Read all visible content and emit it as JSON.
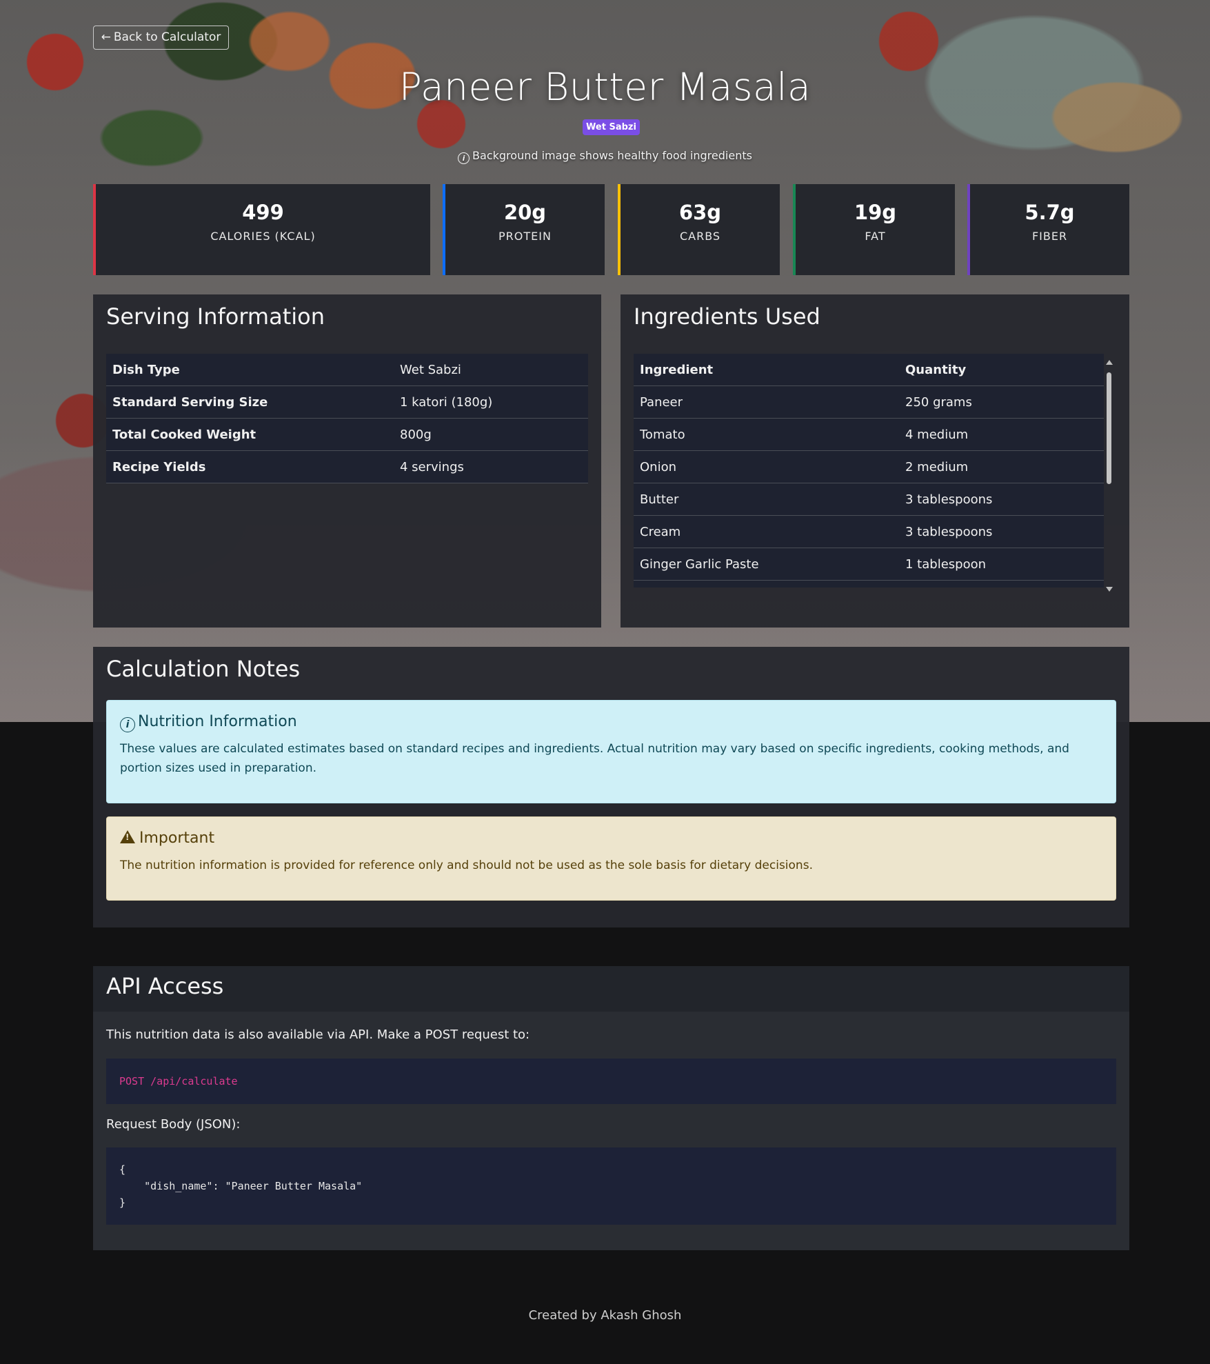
{
  "back_button": {
    "arrow_icon": "arrow-left-icon",
    "label": "Back to Calculator"
  },
  "dish": {
    "title": "Paneer Butter Masala",
    "badge": "Wet Sabzi",
    "badge_color": "#7a4ee6"
  },
  "background_note": {
    "icon": "info-circle-icon",
    "text": "Background image shows healthy food ingredients"
  },
  "stats": [
    {
      "value": "499",
      "label": "CALORIES (KCAL)",
      "color": "#dc3545"
    },
    {
      "value": "20g",
      "label": "PROTEIN",
      "color": "#0d6efd"
    },
    {
      "value": "63g",
      "label": "CARBS",
      "color": "#ffc107"
    },
    {
      "value": "19g",
      "label": "FAT",
      "color": "#198754"
    },
    {
      "value": "5.7g",
      "label": "FIBER",
      "color": "#6f42c1"
    }
  ],
  "serving": {
    "title": "Serving Information",
    "rows": [
      {
        "key": "Dish Type",
        "value": "Wet Sabzi"
      },
      {
        "key": "Standard Serving Size",
        "value": "1 katori (180g)"
      },
      {
        "key": "Total Cooked Weight",
        "value": "800g"
      },
      {
        "key": "Recipe Yields",
        "value": "4 servings"
      }
    ]
  },
  "ingredients": {
    "title": "Ingredients Used",
    "headers": [
      "Ingredient",
      "Quantity"
    ],
    "rows": [
      {
        "name": "Paneer",
        "qty": "250 grams"
      },
      {
        "name": "Tomato",
        "qty": "4 medium"
      },
      {
        "name": "Onion",
        "qty": "2 medium"
      },
      {
        "name": "Butter",
        "qty": "3 tablespoons"
      },
      {
        "name": "Cream",
        "qty": "3 tablespoons"
      },
      {
        "name": "Ginger Garlic Paste",
        "qty": "1 tablespoon"
      }
    ]
  },
  "notes": {
    "title": "Calculation Notes",
    "info": {
      "icon": "info-circle-icon",
      "title": "Nutrition Information",
      "text": "These values are calculated estimates based on standard recipes and ingredients. Actual nutrition may vary based on specific ingredients, cooking methods, and portion sizes used in preparation."
    },
    "warning": {
      "icon": "warning-triangle-icon",
      "title": "Important",
      "text": "The nutrition information is provided for reference only and should not be used as the sole basis for dietary decisions."
    }
  },
  "api": {
    "title": "API Access",
    "intro": "This nutrition data is also available via API. Make a POST request to:",
    "endpoint": "POST /api/calculate",
    "body_label": "Request Body (JSON):",
    "body": "{\n    \"dish_name\": \"Paneer Butter Masala\"\n}"
  },
  "footer": "Created by Akash Ghosh"
}
